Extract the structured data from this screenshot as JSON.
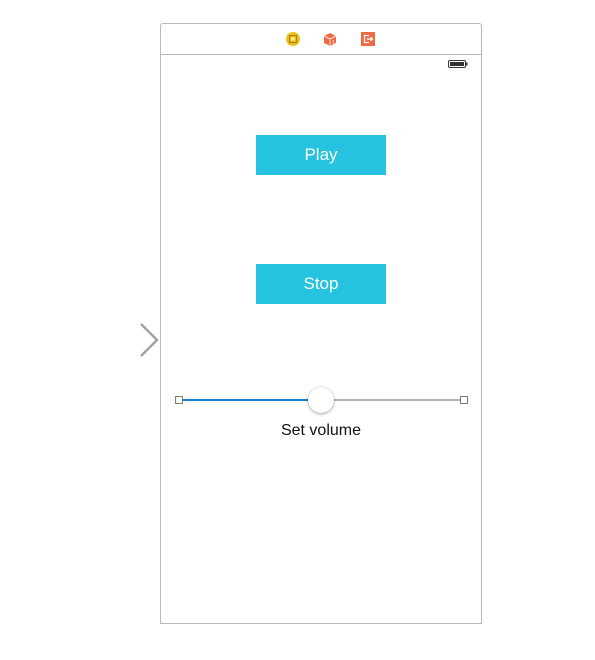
{
  "scene": {
    "dock_icons": [
      {
        "name": "view-controller-icon",
        "color": "#f2c21b"
      },
      {
        "name": "first-responder-icon",
        "color": "#ee6b45"
      },
      {
        "name": "exit-icon",
        "color": "#ee6b45"
      }
    ],
    "status_bar": {
      "battery": "full"
    }
  },
  "buttons": {
    "play_label": "Play",
    "stop_label": "Stop",
    "color": "#26c3e0"
  },
  "slider": {
    "value": 0.5,
    "min_track_color": "#1a7fd6",
    "max_track_color": "#b5b5b5"
  },
  "volume_label": "Set volume",
  "entry_point": {
    "icon": "initial-view-controller-arrow-icon"
  }
}
